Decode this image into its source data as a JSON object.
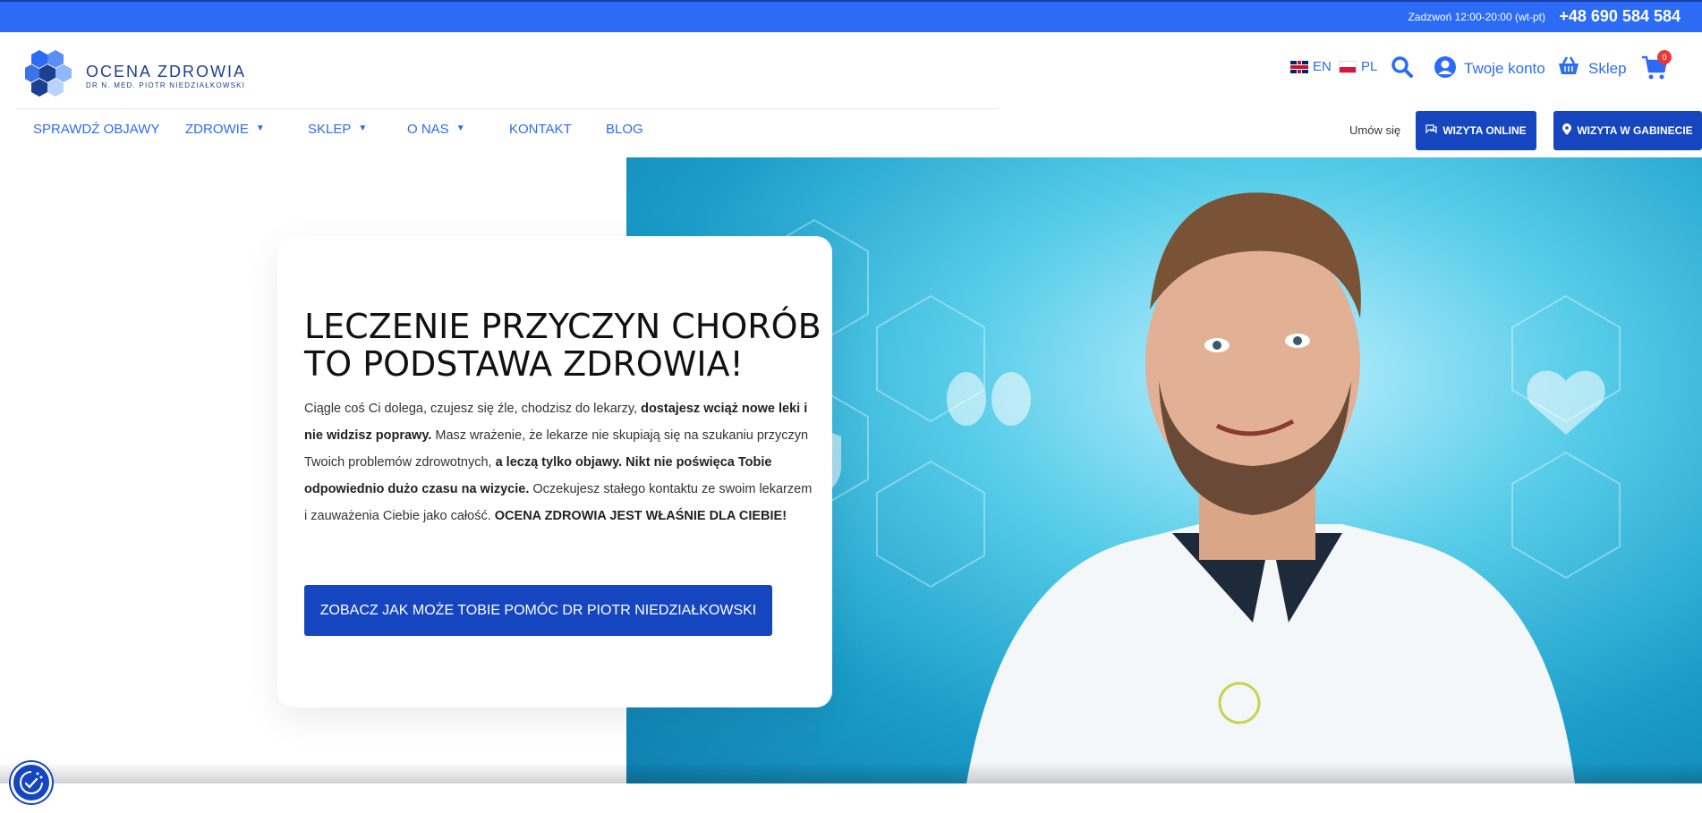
{
  "topbar": {
    "call_text": "Zadzwoń 12:00-20:00 (wt-pt)",
    "phone": "+48 690 584 584",
    "color": "#2b6bf6"
  },
  "header": {
    "logo": {
      "title": "OCENA ZDROWIA",
      "subtitle": "DR N. MED. PIOTR NIEDZIAŁKOWSKI"
    },
    "lang_en": "EN",
    "lang_pl": "PL",
    "account_label": "Twoje konto",
    "shop_label": "Sklep",
    "cart_count": "0",
    "icons": [
      "search-icon",
      "user-icon",
      "basket-icon",
      "cart-icon"
    ]
  },
  "nav": {
    "items": [
      {
        "label": "SPRAWDŹ OBJAWY",
        "dropdown": false
      },
      {
        "label": "ZDROWIE",
        "dropdown": true
      },
      {
        "label": "SKLEP",
        "dropdown": true
      },
      {
        "label": "O NAS",
        "dropdown": true
      },
      {
        "label": "KONTAKT",
        "dropdown": false
      },
      {
        "label": "BLOG",
        "dropdown": false
      }
    ],
    "book_label": "Umów się",
    "btn_online": "WIZYTA ONLINE",
    "btn_office": "WIZYTA W GABINECIE"
  },
  "hero": {
    "heading": "LECZENIE PRZYCZYN CHORÓB TO PODSTAWA ZDROWIA!",
    "para": [
      {
        "text": "Ciągle coś Ci dolega, czujesz się źle, chodzisz do lekarzy, ",
        "bold": false
      },
      {
        "text": "dostajesz wciąż nowe leki i nie widzisz poprawy.",
        "bold": true
      },
      {
        "text": " Masz wrażenie, że lekarze nie skupiają się na szukaniu przyczyn Twoich problemów zdrowotnych, ",
        "bold": false
      },
      {
        "text": "a leczą tylko objawy. Nikt nie poświęca Tobie odpowiednio dużo czasu na wizycie.",
        "bold": true
      },
      {
        "text": " Oczekujesz stałego kontaktu ze swoim lekarzem i zauważenia Ciebie jako całość. ",
        "bold": false
      },
      {
        "text": "OCENA ZDROWIA JEST WŁAŚNIE DLA CIEBIE!",
        "bold": true
      }
    ],
    "cta": "ZOBACZ JAK MOŻE TOBIE POMÓC DR PIOTR NIEDZIAŁKOWSKI",
    "accent": "#1546c0"
  },
  "cookie": {
    "icon": "cookie-settings-icon"
  }
}
